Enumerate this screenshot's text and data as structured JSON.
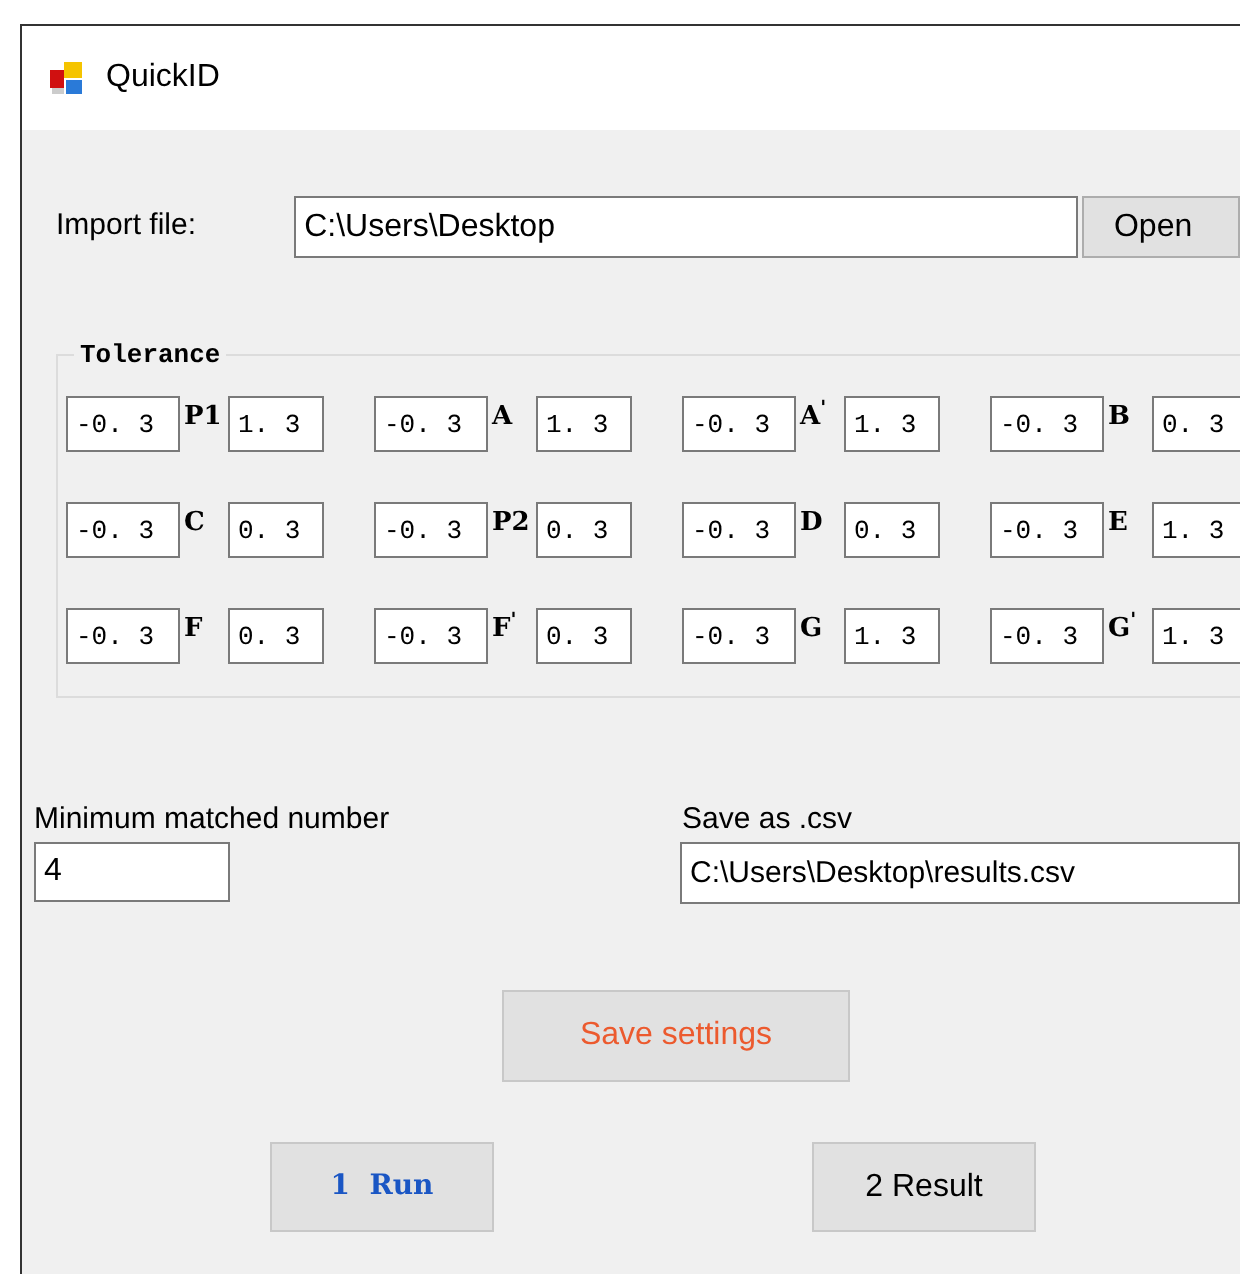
{
  "window": {
    "title": "QuickID"
  },
  "import": {
    "label": "Import file:",
    "value": "C:\\Users\\Desktop",
    "button": "Open"
  },
  "tolerance": {
    "title": "Tolerance",
    "rows": [
      [
        {
          "min": "-0. 3",
          "label": "P1",
          "max": "1. 3"
        },
        {
          "min": "-0. 3",
          "label": "A",
          "max": "1. 3"
        },
        {
          "min": "-0. 3",
          "label": "A$^{'}$",
          "max": "1. 3"
        },
        {
          "min": "-0. 3",
          "label": "B",
          "max": "0. 3"
        }
      ],
      [
        {
          "min": "-0. 3",
          "label": "C",
          "max": "0. 3"
        },
        {
          "min": "-0. 3",
          "label": "P2",
          "max": "0. 3"
        },
        {
          "min": "-0. 3",
          "label": "D",
          "max": "0. 3"
        },
        {
          "min": "-0. 3",
          "label": "E",
          "max": "1. 3"
        }
      ],
      [
        {
          "min": "-0. 3",
          "label": "F",
          "max": "0. 3"
        },
        {
          "min": "-0. 3",
          "label": "F$^{'}$",
          "max": "0. 3"
        },
        {
          "min": "-0. 3",
          "label": "G",
          "max": "1. 3"
        },
        {
          "min": "-0. 3",
          "label": "G$^{'}$",
          "max": "1. 3"
        }
      ]
    ]
  },
  "min_matched": {
    "label": "Minimum matched number",
    "value": "4"
  },
  "save_csv": {
    "label": "Save as .csv",
    "value": "C:\\Users\\Desktop\\results.csv"
  },
  "buttons": {
    "save_settings": "Save settings",
    "run": "1  Run",
    "result": "2 Result"
  }
}
